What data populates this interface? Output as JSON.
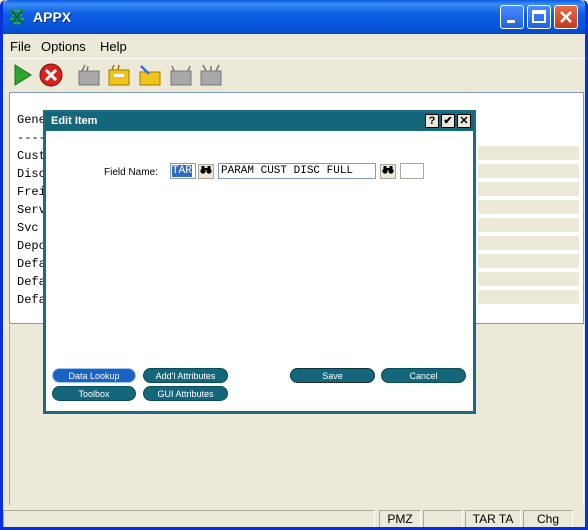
{
  "window": {
    "title": "APPX"
  },
  "menu": [
    "File",
    "Options",
    "Help"
  ],
  "toolbar": {
    "icons": [
      "go-icon",
      "cancel-icon",
      "tool-icon-1",
      "tool-icon-2",
      "tool-icon-3",
      "tool-icon-4",
      "tool-icon-5"
    ]
  },
  "background_rows": [
    "Gene",
    "----",
    "Cust",
    "Disc",
    "Frei",
    "Serv",
    "Svc ",
    "Depo",
    "Defa",
    "Defa",
    "Defa"
  ],
  "dialog": {
    "title": "Edit Item",
    "help_btn": "?",
    "ok_btn": "✔",
    "close_btn": "✕",
    "field_label": "Field Name:",
    "field_code": "TAR",
    "field_value": "PARAM CUST DISC FULL",
    "buttons": {
      "data_lookup": "Data Lookup",
      "addl_attributes": "Add'l Attributes",
      "toolbox": "Toolbox",
      "gui_attributes": "GUI Attributes",
      "save": "Save",
      "cancel": "Cancel"
    }
  },
  "statusbar": {
    "cells": [
      "PMZ",
      "",
      "TAR TA",
      "Chg"
    ]
  }
}
